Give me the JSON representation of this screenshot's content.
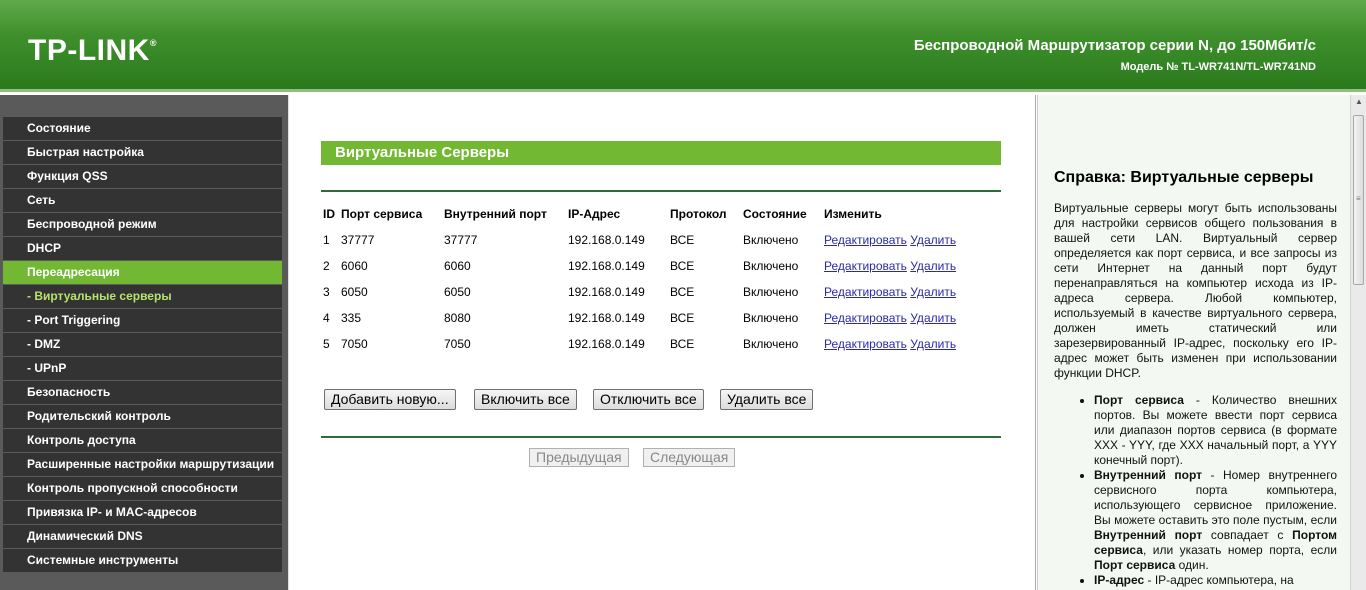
{
  "header": {
    "logo": "TP-LINK",
    "logo_mark": "®",
    "title": "Беспроводной Маршрутизатор серии N, до 150Мбит/с",
    "model": "Модель № TL-WR741N/TL-WR741ND"
  },
  "sidebar": {
    "items": [
      {
        "label": "Состояние"
      },
      {
        "label": "Быстрая настройка"
      },
      {
        "label": "Функция QSS"
      },
      {
        "label": "Сеть"
      },
      {
        "label": "Беспроводной режим"
      },
      {
        "label": "DHCP"
      },
      {
        "label": "Переадресация"
      },
      {
        "label": "- Виртуальные серверы"
      },
      {
        "label": "- Port Triggering"
      },
      {
        "label": "- DMZ"
      },
      {
        "label": "- UPnP"
      },
      {
        "label": "Безопасность"
      },
      {
        "label": "Родительский контроль"
      },
      {
        "label": "Контроль доступа"
      },
      {
        "label": "Расширенные настройки маршрутизации"
      },
      {
        "label": "Контроль пропускной способности"
      },
      {
        "label": "Привязка IP- и MAC-адресов"
      },
      {
        "label": "Динамический DNS"
      },
      {
        "label": "Системные инструменты"
      }
    ],
    "active_color": "#72b833"
  },
  "main": {
    "title": "Виртуальные Серверы",
    "columns": [
      "ID",
      "Порт сервиса",
      "Внутренний порт",
      "IP-Адрес",
      "Протокол",
      "Состояние",
      "Изменить"
    ],
    "rows": [
      {
        "id": "1",
        "service_port": "37777",
        "internal_port": "37777",
        "ip": "192.168.0.149",
        "protocol": "ВСЕ",
        "status": "Включено",
        "edit": "Редактировать",
        "delete": "Удалить"
      },
      {
        "id": "2",
        "service_port": "6060",
        "internal_port": "6060",
        "ip": "192.168.0.149",
        "protocol": "ВСЕ",
        "status": "Включено",
        "edit": "Редактировать",
        "delete": "Удалить"
      },
      {
        "id": "3",
        "service_port": "6050",
        "internal_port": "6050",
        "ip": "192.168.0.149",
        "protocol": "ВСЕ",
        "status": "Включено",
        "edit": "Редактировать",
        "delete": "Удалить"
      },
      {
        "id": "4",
        "service_port": "335",
        "internal_port": "8080",
        "ip": "192.168.0.149",
        "protocol": "ВСЕ",
        "status": "Включено",
        "edit": "Редактировать",
        "delete": "Удалить"
      },
      {
        "id": "5",
        "service_port": "7050",
        "internal_port": "7050",
        "ip": "192.168.0.149",
        "protocol": "ВСЕ",
        "status": "Включено",
        "edit": "Редактировать",
        "delete": "Удалить"
      }
    ],
    "buttons": {
      "add": "Добавить новую...",
      "enable_all": "Включить все",
      "disable_all": "Отключить все",
      "delete_all": "Удалить все",
      "prev": "Предыдущая",
      "next": "Следующая"
    }
  },
  "help": {
    "title": "Справка: Виртуальные серверы",
    "intro": "Виртуальные серверы могут быть использованы для настройки сервисов общего пользования в вашей сети LAN. Виртуальный сервер определяется как порт сервиса, и все запросы из сети Интернет на данный порт будут перенаправляться на компьютер исхода из IP-адреса сервера. Любой компьютер, используемый в качестве виртуального сервера, должен иметь статический или зарезервированный IP-адрес, поскольку его IP-адрес может быть изменен при использовании функции DHCP.",
    "item1_term": "Порт сервиса",
    "item1_text": " - Количество внешних портов. Вы можете ввести порт сервиса или диапазон портов сервиса (в формате XXX - YYY, где XXX начальный порт, а YYY конечный порт).",
    "item2_term": "Внутренний порт",
    "item2_text1": " - Номер внутреннего сервисного порта компьютера, использующего сервисное приложение. Вы можете оставить это поле пустым, если ",
    "item2_term2": "Внутренний порт",
    "item2_text2": " совпадает с ",
    "item2_term3": "Портом сервиса",
    "item2_text3": ", или указать номер порта, если ",
    "item2_term4": "Порт сервиса",
    "item2_text4": " один.",
    "item3_term": "IP-адрес",
    "item3_text": " - IP-адрес компьютера, на"
  },
  "colors": {
    "header_green": "#3e8f2c",
    "accent_green": "#72b833",
    "sidebar_dark": "#333333",
    "link_blue": "#2a2aa8"
  }
}
